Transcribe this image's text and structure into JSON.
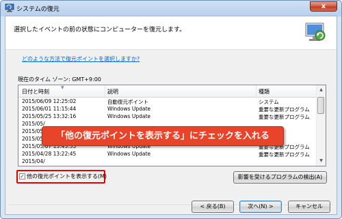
{
  "window": {
    "title": "システムの復元",
    "close_glyph": "x"
  },
  "header": {
    "instruction": "選択したイベントの前の状態にコンピューターを復元します。"
  },
  "help_link": "どのような方法で復元ポイントを選択しますか?",
  "timezone": "現在のタイム ゾーン: GMT+9:00",
  "table": {
    "columns": [
      "日付と時刻",
      "説明",
      "種類"
    ],
    "rows": [
      [
        "2015/06/09 12:25:02",
        "自動復元ポイント",
        "システム"
      ],
      [
        "2015/06/01 11:15:44",
        "Windows Update",
        "重要な更新プログラム"
      ],
      [
        "2015/05/25 13:32:16",
        "Windows Update",
        "重要な更新プログラム"
      ],
      [
        "2015/05/",
        "",
        ""
      ],
      [
        "2015/05/",
        "",
        ""
      ],
      [
        "2015/05/",
        "",
        ""
      ],
      [
        "2015/05/07 13:43:35",
        "Windows Update",
        "重要な更新プログラム"
      ],
      [
        "2015/04/28 13:22:45",
        "Windows Update",
        "重要な更新プログラム"
      ],
      [
        "2015/04/",
        "",
        ""
      ]
    ]
  },
  "callout": "「他の復元ポイントを表示する」にチェックを入れる",
  "show_more": {
    "label": "他の復元ポイントを表示する(M)",
    "checked": true,
    "check_glyph": "✓"
  },
  "buttons": {
    "scan": "影響を受けるプログラムの検出(A)",
    "back": "< 戻る(B)",
    "next": "次へ(N) >",
    "cancel": "キャンセル"
  },
  "colors": {
    "callout": "#e8442a",
    "highlight": "#e00000",
    "link": "#0066cc"
  }
}
